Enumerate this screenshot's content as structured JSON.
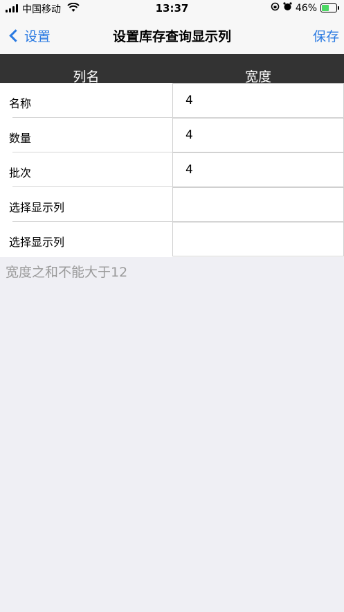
{
  "status_bar": {
    "carrier": "中国移动",
    "time": "13:37",
    "battery": "46%",
    "battery_level": 0.46,
    "icons": [
      "signal-icon",
      "wifi-icon",
      "rotation-lock-icon",
      "alarm-icon",
      "battery-icon"
    ]
  },
  "nav": {
    "back_label": "设置",
    "title": "设置库存查询显示列",
    "save_label": "保存"
  },
  "table": {
    "headers": {
      "name": "列名",
      "width": "宽度"
    },
    "rows": [
      {
        "name": "名称",
        "width": "4"
      },
      {
        "name": "数量",
        "width": "4"
      },
      {
        "name": "批次",
        "width": "4"
      },
      {
        "name": "选择显示列",
        "width": ""
      },
      {
        "name": "选择显示列",
        "width": ""
      }
    ]
  },
  "hint": "宽度之和不能大于12",
  "colors": {
    "accent": "#2a7ae2",
    "header_bg": "#333333",
    "page_bg": "#efeff4"
  }
}
